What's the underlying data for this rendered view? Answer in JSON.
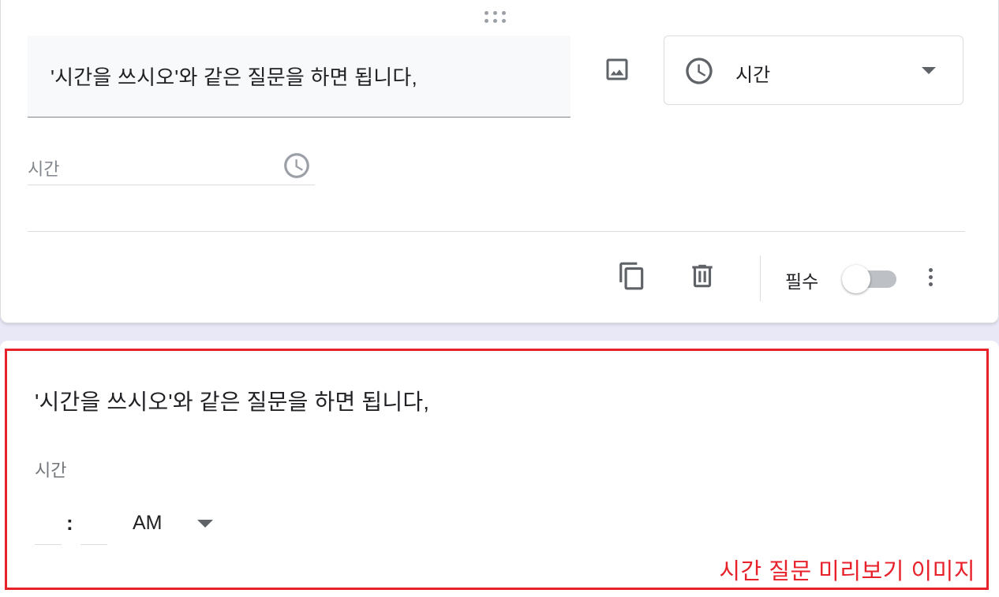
{
  "question_editor": {
    "question_text": "'시간을 쓰시오'와 같은 질문을 하면 됩니다,",
    "question_type": {
      "label": "시간",
      "icon": "clock-icon"
    },
    "image_button_icon": "image-icon",
    "answer_field": {
      "placeholder": "시간",
      "icon": "clock-icon"
    },
    "footer": {
      "duplicate_icon": "copy-icon",
      "delete_icon": "trash-icon",
      "required_label": "필수",
      "required_on": false,
      "more_icon": "more-vert-icon"
    }
  },
  "preview": {
    "question_text": "'시간을 쓰시오'와 같은 질문을 하면 됩니다,",
    "time_label": "시간",
    "hour_value": "",
    "colon": ":",
    "minute_value": "",
    "ampm_value": "AM",
    "annotation": "시간 질문 미리보기 이미지"
  },
  "colors": {
    "annotation_red": "#e8222b",
    "background_lavender": "#e9e8f7",
    "icon_gray": "#5f6368"
  }
}
